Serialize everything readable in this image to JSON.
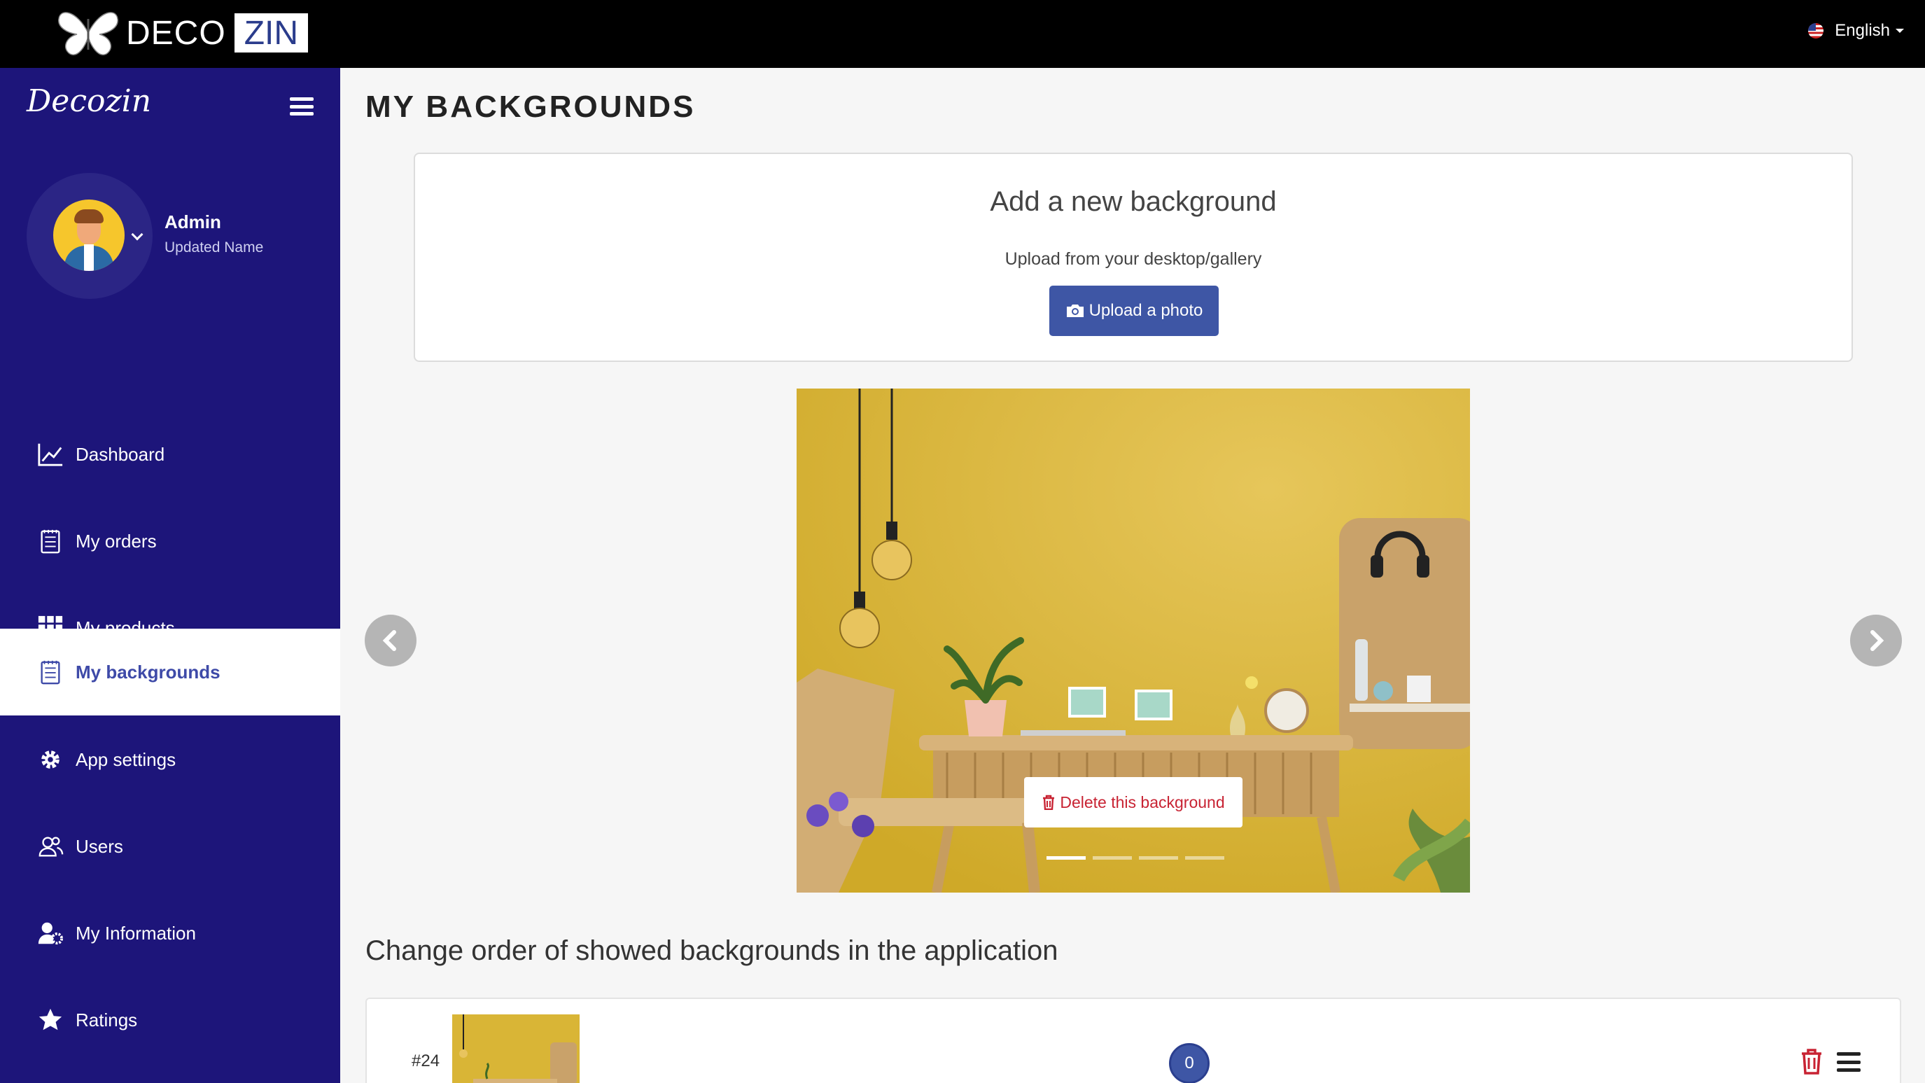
{
  "topbar": {
    "logo_left": "DECO",
    "logo_right": "ZIN",
    "language": "English"
  },
  "sidebar": {
    "brand": "Decozin",
    "user": {
      "name": "Admin",
      "subtitle": "Updated Name"
    },
    "items": [
      {
        "label": "Dashboard",
        "icon": "chart-line-icon"
      },
      {
        "label": "My orders",
        "icon": "clipboard-list-icon"
      },
      {
        "label": "My products",
        "icon": "grid-icon"
      },
      {
        "label": "My backgrounds",
        "icon": "clipboard-list-icon",
        "active": true
      },
      {
        "label": "App settings",
        "icon": "gear-icon"
      },
      {
        "label": "Users",
        "icon": "users-icon"
      },
      {
        "label": "My Information",
        "icon": "user-cog-icon"
      },
      {
        "label": "Ratings",
        "icon": "star-icon"
      }
    ]
  },
  "main": {
    "title": "MY BACKGROUNDS",
    "add_card": {
      "title": "Add a new background",
      "subtitle": "Upload from your desktop/gallery",
      "upload_label": "Upload a photo"
    },
    "carousel": {
      "delete_label": "Delete this background",
      "slide_count": 4,
      "active_slide": 1
    },
    "order": {
      "title": "Change order of showed backgrounds in the application",
      "rows": [
        {
          "number": "#24",
          "position": "0"
        }
      ]
    }
  },
  "colors": {
    "sidebar": "#1d157a",
    "accent": "#3e56a5",
    "danger": "#c82333",
    "topbar": "#000000"
  }
}
